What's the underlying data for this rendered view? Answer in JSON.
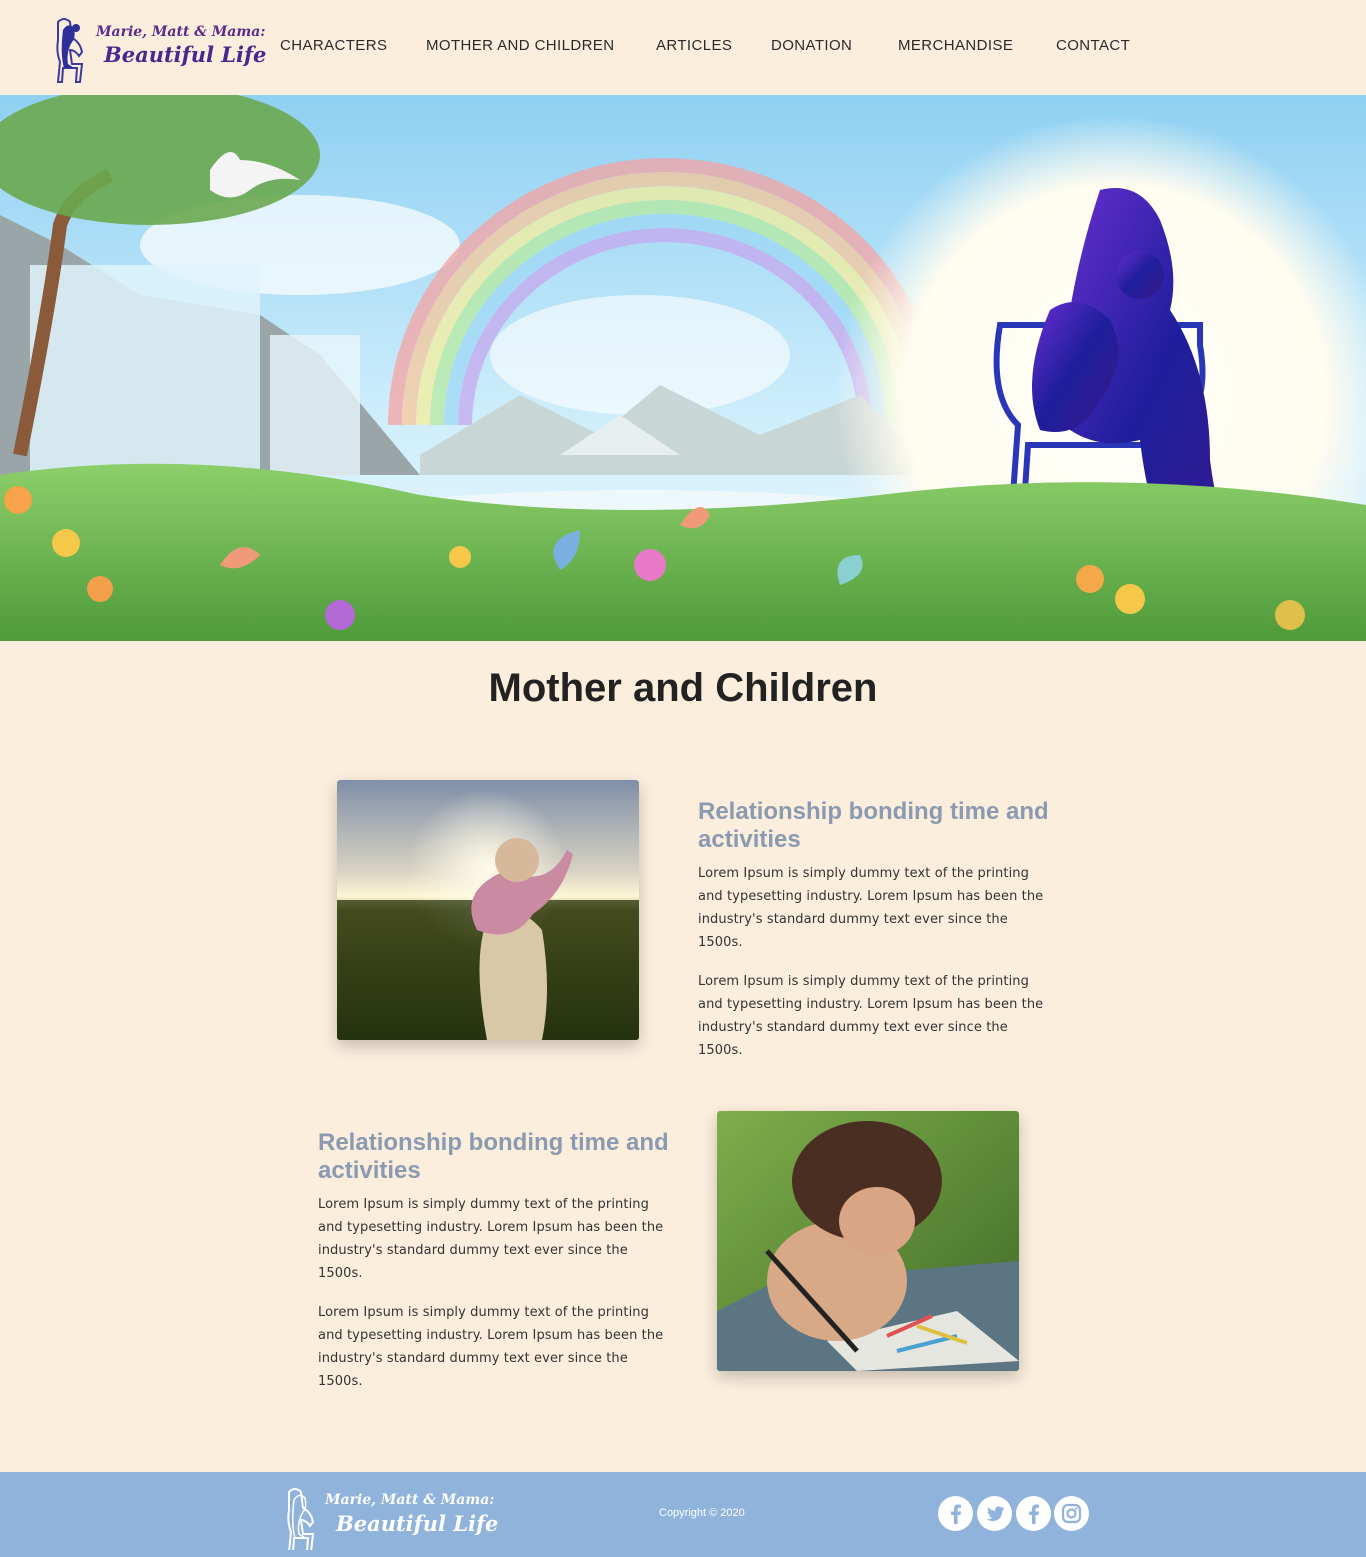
{
  "brand": {
    "logo_line1": "Marie, Matt & Mama:",
    "logo_line2": "Beautiful Life"
  },
  "nav": {
    "items": [
      "CHARACTERS",
      "MOTHER AND CHILDREN",
      "ARTICLES",
      "DONATION",
      "MERCHANDISE",
      "CONTACT"
    ]
  },
  "page": {
    "title": "Mother and Children"
  },
  "sections": [
    {
      "heading": "Relationship bonding time and activities",
      "paragraphs": [
        "Lorem Ipsum is simply dummy text of the printing and typesetting industry. Lorem Ipsum has been the industry's standard dummy text ever since the 1500s.",
        "Lorem Ipsum is simply dummy text of the printing and typesetting industry. Lorem Ipsum has been the industry's standard dummy text ever since the 1500s."
      ],
      "image": "child-on-shoulders-sunset-photo"
    },
    {
      "heading": "Relationship bonding time and activities",
      "paragraphs": [
        "Lorem Ipsum is simply dummy text of the printing and typesetting industry. Lorem Ipsum has been the industry's standard dummy text ever since the 1500s.",
        "Lorem Ipsum is simply dummy text of the printing and typesetting industry. Lorem Ipsum has been the industry's standard dummy text ever since the 1500s."
      ],
      "image": "child-drawing-crayons-photo"
    }
  ],
  "footer": {
    "logo_line1": "Marie, Matt & Mama:",
    "logo_line2": "Beautiful Life",
    "copyright": "Copyright © 2020",
    "social": [
      "facebook-icon",
      "twitter-icon",
      "facebook-icon",
      "instagram-icon"
    ]
  },
  "colors": {
    "background": "#fbeedd",
    "footer": "#8fb3da",
    "heading_accent": "#8a9ab1",
    "brand_purple": "#46298f"
  }
}
